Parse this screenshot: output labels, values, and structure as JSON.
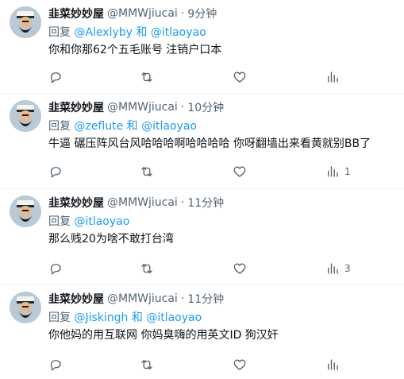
{
  "tweets": [
    {
      "name": "韭菜妙妙屋",
      "handle": "@MMWjiucai",
      "dot": "·",
      "time": "9分钟",
      "reply_prefix": "回复 ",
      "mentions": [
        "@Alexlyby",
        "@itlaoyao"
      ],
      "joiner": " 和 ",
      "text": "你和你那62个五毛账号 注销户口本",
      "replies": "",
      "retweets": "",
      "likes": "",
      "views": ""
    },
    {
      "name": "韭菜妙妙屋",
      "handle": "@MMWjiucai",
      "dot": "·",
      "time": "10分钟",
      "reply_prefix": "回复 ",
      "mentions": [
        "@zeflute",
        "@itlaoyao"
      ],
      "joiner": " 和 ",
      "text": "牛逼 碾压阵风台风哈哈哈啊哈哈哈哈  你呀翻墙出来看黄就别BB了",
      "replies": "",
      "retweets": "",
      "likes": "",
      "views": "1"
    },
    {
      "name": "韭菜妙妙屋",
      "handle": "@MMWjiucai",
      "dot": "·",
      "time": "11分钟",
      "reply_prefix": "回复 ",
      "mentions": [
        "@itlaoyao"
      ],
      "joiner": "",
      "text": "那么贱20为啥不敢打台湾",
      "replies": "",
      "retweets": "",
      "likes": "",
      "views": "3"
    },
    {
      "name": "韭菜妙妙屋",
      "handle": "@MMWjiucai",
      "dot": "·",
      "time": "11分钟",
      "reply_prefix": "回复 ",
      "mentions": [
        "@Jiskingh",
        "@itlaoyao"
      ],
      "joiner": " 和 ",
      "text": "你他妈的用互联网 你妈臭嗨的用英文ID 狗汉奸",
      "replies": "",
      "retweets": "",
      "likes": "",
      "views": ""
    }
  ],
  "icons": {
    "reply": "reply-icon",
    "retweet": "retweet-icon",
    "like": "heart-icon",
    "views": "views-icon"
  },
  "colors": {
    "mention": "#1d9bf0",
    "secondary": "#536471",
    "text": "#0f1419",
    "divider": "#eff3f4"
  }
}
